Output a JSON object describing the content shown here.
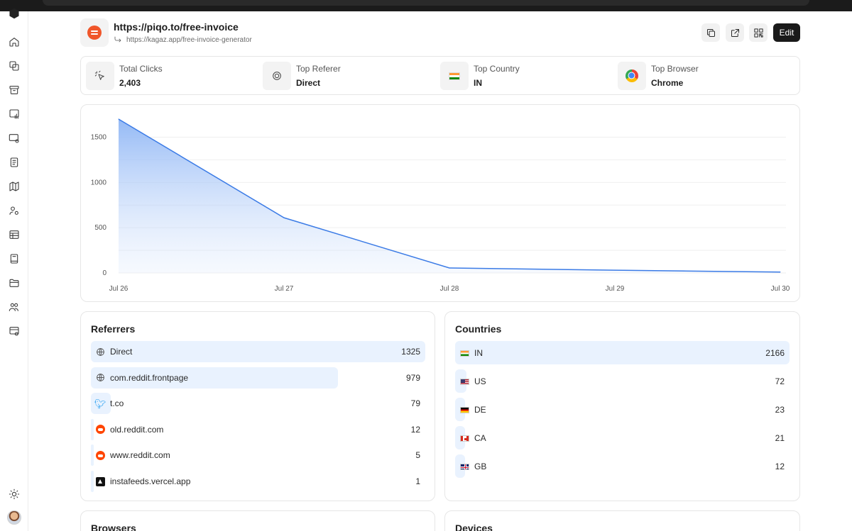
{
  "link": {
    "short_url": "https://piqo.to/free-invoice",
    "destination_url": "https://kagaz.app/free-invoice-generator"
  },
  "actions": {
    "edit_label": "Edit",
    "copy_icon": "copy-icon",
    "open_icon": "external-link-icon",
    "qr_icon": "qr-code-icon"
  },
  "stats": {
    "total_clicks": {
      "label": "Total Clicks",
      "value": "2,403"
    },
    "top_referer": {
      "label": "Top Referer",
      "value": "Direct"
    },
    "top_country": {
      "label": "Top Country",
      "value": "IN"
    },
    "top_browser": {
      "label": "Top Browser",
      "value": "Chrome"
    }
  },
  "chart_data": {
    "type": "area",
    "x": [
      "Jul 26",
      "Jul 27",
      "Jul 28",
      "Jul 29",
      "Jul 30"
    ],
    "y_ticks": [
      0,
      500,
      1000,
      1500
    ],
    "series": [
      {
        "values": [
          1700,
          610,
          55,
          30,
          10
        ]
      }
    ],
    "ylim": [
      0,
      1700
    ],
    "grid": true,
    "colors": {
      "line": "#3b7be6",
      "fill_top": "#8fb6f5"
    }
  },
  "referrers": {
    "title": "Referrers",
    "items": [
      {
        "label": "Direct",
        "count": "1325",
        "value": 1325,
        "icon": "globe-icon"
      },
      {
        "label": "com.reddit.frontpage",
        "count": "979",
        "value": 979,
        "icon": "globe-icon"
      },
      {
        "label": "t.co",
        "count": "79",
        "value": 79,
        "icon": "twitter-icon"
      },
      {
        "label": "old.reddit.com",
        "count": "12",
        "value": 12,
        "icon": "reddit-icon"
      },
      {
        "label": "www.reddit.com",
        "count": "5",
        "value": 5,
        "icon": "reddit-icon"
      },
      {
        "label": "instafeeds.vercel.app",
        "count": "1",
        "value": 1,
        "icon": "vercel-icon"
      }
    ]
  },
  "countries": {
    "title": "Countries",
    "items": [
      {
        "label": "IN",
        "count": "2166",
        "value": 2166
      },
      {
        "label": "US",
        "count": "72",
        "value": 72
      },
      {
        "label": "DE",
        "count": "23",
        "value": 23
      },
      {
        "label": "CA",
        "count": "21",
        "value": 21
      },
      {
        "label": "GB",
        "count": "12",
        "value": 12
      }
    ]
  },
  "browsers": {
    "title": "Browsers"
  },
  "devices": {
    "title": "Devices"
  },
  "sidebar": {
    "icons": [
      "box-logo-icon",
      "home-icon",
      "links-icon",
      "archive-icon",
      "analytics-icon",
      "media-settings-icon",
      "notes-icon",
      "map-icon",
      "team-settings-icon",
      "table-icon",
      "book-icon",
      "folder-icon",
      "users-icon",
      "domain-settings-icon",
      "theme-toggle-icon"
    ]
  }
}
